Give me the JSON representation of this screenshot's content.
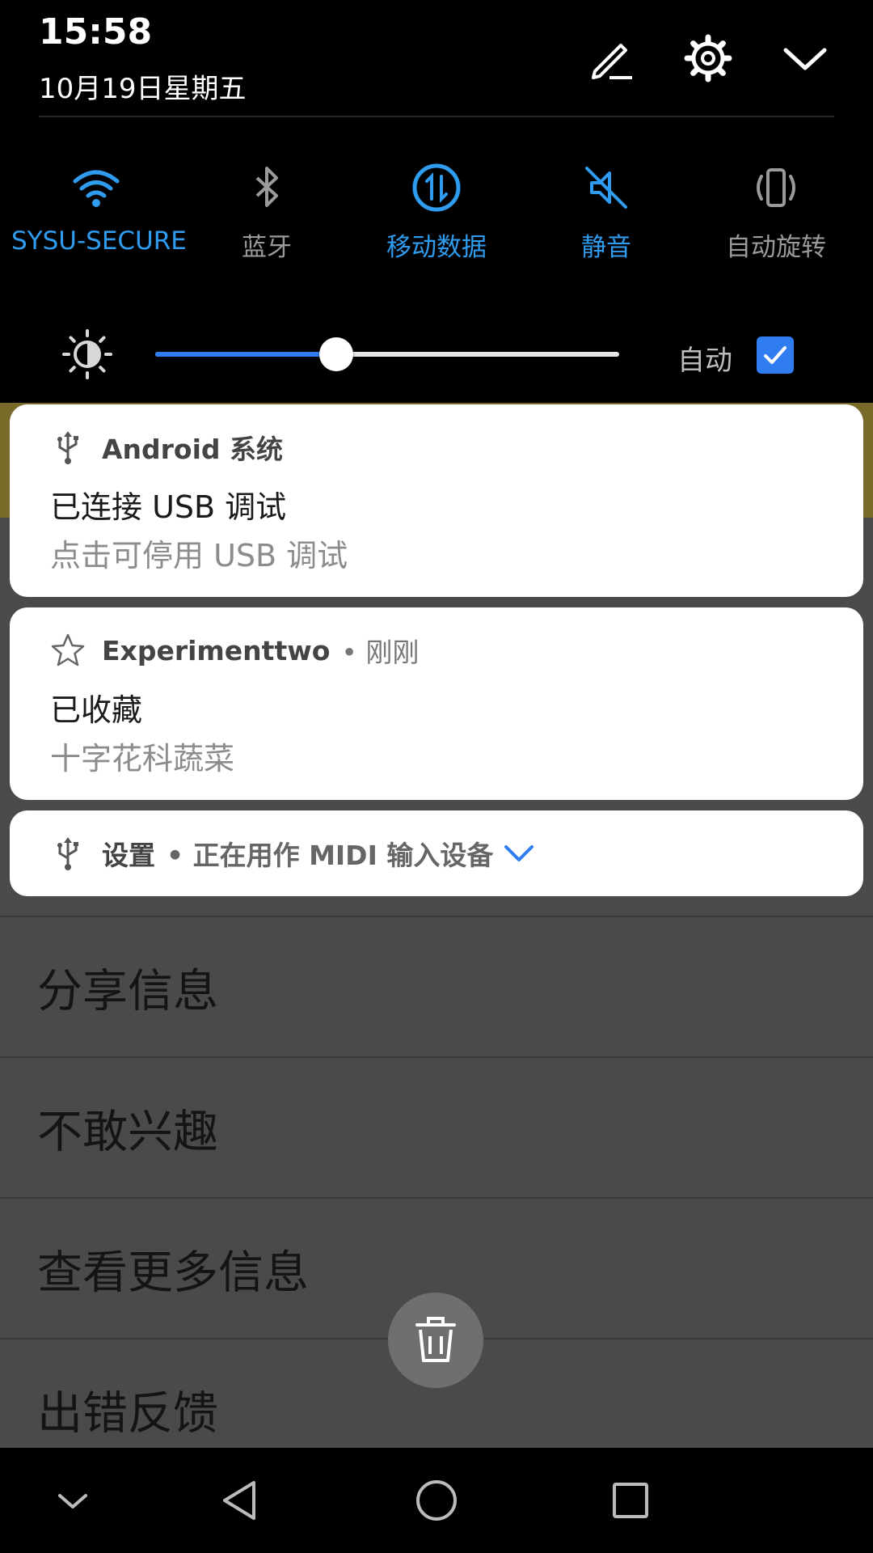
{
  "status": {
    "time": "15:58",
    "date": "10月19日星期五"
  },
  "header_icons": [
    "edit-icon",
    "settings-icon",
    "collapse-chevron-icon"
  ],
  "quick_toggles": [
    {
      "label": "SYSU-SECURE",
      "icon": "wifi-icon",
      "active": true
    },
    {
      "label": "蓝牙",
      "icon": "bluetooth-icon",
      "active": false
    },
    {
      "label": "移动数据",
      "icon": "mobile-data-icon",
      "active": true
    },
    {
      "label": "静音",
      "icon": "mute-icon",
      "active": true
    },
    {
      "label": "自动旋转",
      "icon": "auto-rotate-icon",
      "active": false
    }
  ],
  "brightness": {
    "level": 0.39,
    "auto_label": "自动",
    "auto_checked": true
  },
  "notifications": [
    {
      "app": "Android 系统",
      "meta": "",
      "icon": "usb-icon",
      "title": "已连接 USB 调试",
      "subtitle": "点击可停用 USB 调试"
    },
    {
      "app": "Experimenttwo",
      "meta": "• 刚刚",
      "icon": "star-icon",
      "title": "已收藏",
      "subtitle": "十字花科蔬菜"
    },
    {
      "app": "设置",
      "meta": "• 正在用作 MIDI 输入设备",
      "icon": "usb-icon"
    }
  ],
  "background_menu": {
    "items": [
      "分享信息",
      "不敢兴趣",
      "查看更多信息",
      "出错反馈"
    ]
  },
  "fab_icon": "trash-icon",
  "nav": [
    "hide-nav-icon",
    "back-icon",
    "home-icon",
    "recents-icon"
  ],
  "colors": {
    "accent": "#2f9cf0",
    "inactive": "#9a9a9a",
    "panel_bg": "#000000",
    "card_bg": "#ffffff"
  }
}
